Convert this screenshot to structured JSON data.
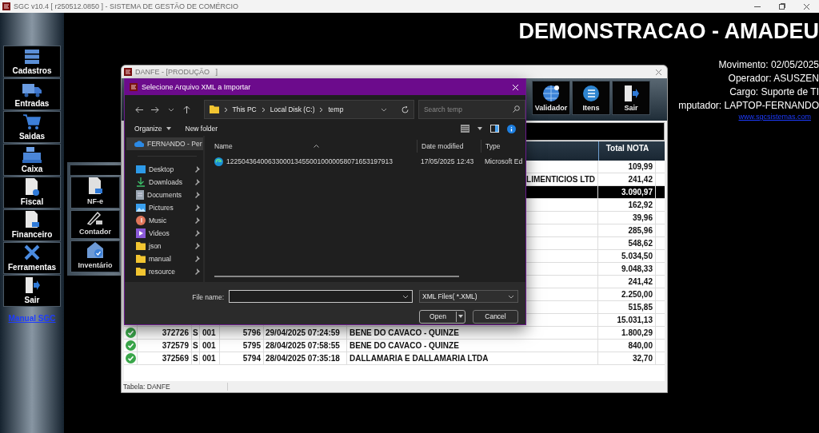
{
  "window": {
    "title": "SGC v10.4 [ r250512.0850 ] - SISTEMA DE GESTÃO DE COMÉRCIO"
  },
  "sidebar": {
    "items": [
      {
        "label": "Cadastros"
      },
      {
        "label": "Entradas"
      },
      {
        "label": "Saidas"
      },
      {
        "label": "Caixa"
      },
      {
        "label": "Fiscal"
      },
      {
        "label": "Financeiro"
      },
      {
        "label": "Ferramentas"
      },
      {
        "label": "Sair"
      }
    ],
    "link": "Manual SGC"
  },
  "submenu": {
    "items": [
      {
        "label": "NF-e"
      },
      {
        "label": "Contador"
      },
      {
        "label": "Inventário"
      }
    ]
  },
  "header": {
    "company": "DEMONSTRACAO - AMADEU",
    "info": [
      "Movimento: 02/05/2025",
      "Operador: ASUSZEN",
      "Cargo: Suporte de TI",
      "mputador: LAPTOP-FERNANDO"
    ],
    "link": "www.sgcsistemas.com"
  },
  "danfe_window": {
    "title": "DANFE - [PRODUÇÃO   ]",
    "toolbar": [
      {
        "label": "Validador"
      },
      {
        "label": "Itens"
      },
      {
        "label": "Sair"
      }
    ],
    "table": {
      "columns": [
        {
          "label": "Total NOTA"
        }
      ],
      "rows": [
        {
          "total": "109,99",
          "selected": false
        },
        {
          "name": "LIMENTICIOS LTD",
          "total": "241,42",
          "selected": false
        },
        {
          "total": "3.090,97",
          "selected": true
        },
        {
          "total": "162,92",
          "selected": false
        },
        {
          "total": "39,96",
          "selected": false
        },
        {
          "total": "285,96",
          "selected": false
        },
        {
          "total": "548,62",
          "selected": false
        },
        {
          "total": "5.034,50",
          "selected": false
        },
        {
          "total": "9.048,33",
          "selected": false
        },
        {
          "total": "241,42",
          "selected": false
        },
        {
          "total": "2.250,00",
          "selected": false
        },
        {
          "total": "515,85",
          "selected": false
        },
        {
          "total": "15.031,13",
          "selected": false
        },
        {
          "valid": true,
          "numero": "372726",
          "serie_tipo": "S",
          "serie": "001",
          "nf": "5796",
          "date": "29/04/2025 07:24:59",
          "name": "BENE DO CAVACO - QUINZE",
          "total": "1.800,29",
          "selected": false
        },
        {
          "valid": true,
          "numero": "372579",
          "serie_tipo": "S",
          "serie": "001",
          "nf": "5795",
          "date": "28/04/2025 07:58:55",
          "name": "BENE DO CAVACO - QUINZE",
          "total": "840,00",
          "selected": false
        },
        {
          "valid": true,
          "numero": "372569",
          "serie_tipo": "S",
          "serie": "001",
          "nf": "5794",
          "date": "28/04/2025 07:35:18",
          "name": "DALLAMARIA E DALLAMARIA LTDA",
          "total": "32,70",
          "selected": false
        }
      ]
    },
    "status_bar": "Tabela: DANFE"
  },
  "dialog": {
    "title": "Selecione Arquivo XML a Importar",
    "breadcrumb": [
      "This PC",
      "Local Disk (C:)",
      "temp"
    ],
    "search": {
      "placeholder": "Search temp"
    },
    "commands": [
      "Organize",
      "New folder"
    ],
    "nav": [
      {
        "label": "FERNANDO - Per",
        "selected": true,
        "pinned": false
      },
      {
        "label": "Desktop",
        "selected": false,
        "pinned": true
      },
      {
        "label": "Downloads",
        "selected": false,
        "pinned": true
      },
      {
        "label": "Documents",
        "selected": false,
        "pinned": true
      },
      {
        "label": "Pictures",
        "selected": false,
        "pinned": true
      },
      {
        "label": "Music",
        "selected": false,
        "pinned": true
      },
      {
        "label": "Videos",
        "selected": false,
        "pinned": true
      },
      {
        "label": "json",
        "selected": false,
        "pinned": true
      },
      {
        "label": "manual",
        "selected": false,
        "pinned": true
      },
      {
        "label": "resource",
        "selected": false,
        "pinned": true
      }
    ],
    "files": {
      "columns": [
        "Name",
        "Date modified",
        "Type"
      ],
      "rows": [
        {
          "name": "12250436400633000134550010000058071653197913",
          "date": "17/05/2025 12:43",
          "type": "Microsoft Ed"
        }
      ]
    },
    "file_name_label": "File name:",
    "filter": "XML Files( *.XML)",
    "buttons": [
      "Open",
      "Cancel"
    ]
  }
}
